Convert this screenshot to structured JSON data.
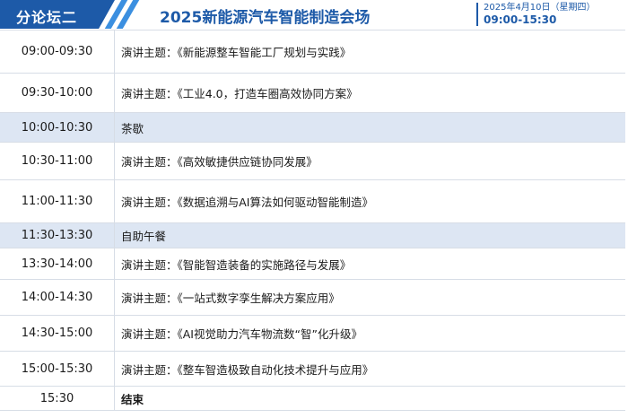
{
  "header": {
    "tag": "分论坛二",
    "title": "2025新能源汽车智能制造会场",
    "date": "2025年4月10日（星期四）",
    "time": "09:00-15:30"
  },
  "colors": {
    "brand_blue": "#1d5aa8",
    "stripe_blue": "#3b8fe0",
    "highlight_row": "#dde6f3"
  },
  "schedule": [
    {
      "time": "09:00-09:30",
      "topic": "演讲主题：《新能源整车智能工厂规划与实践》"
    },
    {
      "time": "09:30-10:00",
      "topic": "演讲主题：《工业4.0，打造车圈高效协同方案》"
    },
    {
      "time": "10:00-10:30",
      "topic": "茶歇"
    },
    {
      "time": "10:30-11:00",
      "topic": "演讲主题：《高效敏捷供应链协同发展》"
    },
    {
      "time": "11:00-11:30",
      "topic": "演讲主题：《数据追溯与AI算法如何驱动智能制造》"
    },
    {
      "time": "11:30-13:30",
      "topic": "自助午餐"
    },
    {
      "time": "13:30-14:00",
      "topic": "演讲主题：《智能智造装备的实施路径与发展》"
    },
    {
      "time": "14:00-14:30",
      "topic": "演讲主题：《一站式数字孪生解决方案应用》"
    },
    {
      "time": "14:30-15:00",
      "topic": "演讲主题：《AI视觉助力汽车物流数“智”化升级》"
    },
    {
      "time": "15:00-15:30",
      "topic": "演讲主题：《整车智造极致自动化技术提升与应用》"
    },
    {
      "time": "15:30",
      "topic": "结束"
    }
  ]
}
